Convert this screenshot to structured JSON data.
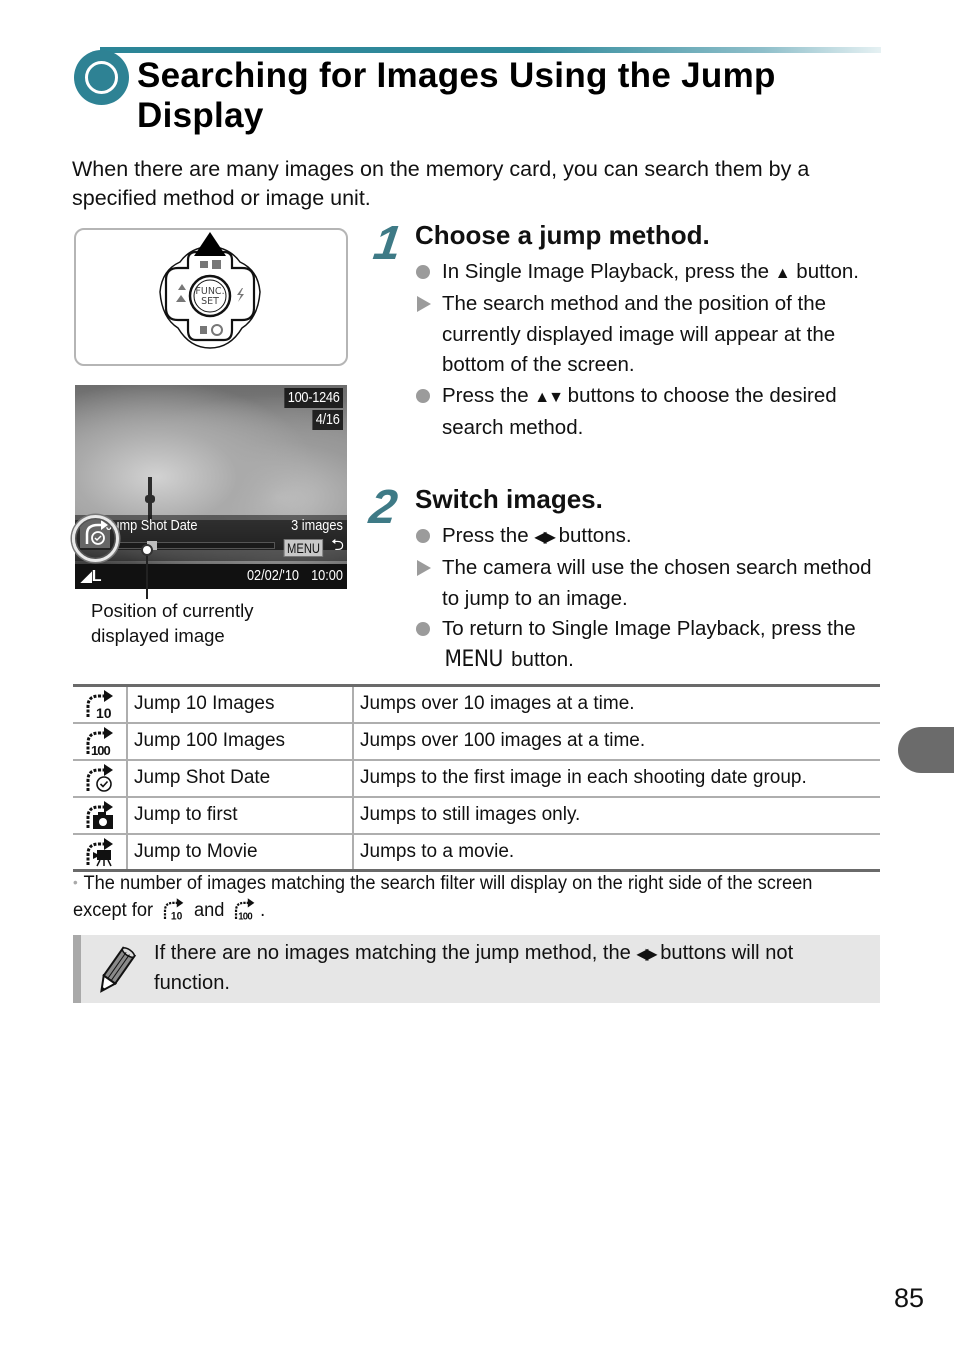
{
  "header": {
    "title": "Searching for Images Using the Jump Display",
    "accent_color": "#2e8294",
    "icon": "section-circle-icon"
  },
  "intro": "When there are many images on the memory card, you can search them by a specified method or image unit.",
  "illustration": {
    "control_pad": {
      "center_label_line1": "FUNC.",
      "center_label_line2": "SET",
      "highlighted_button": "up-arrow"
    },
    "camera_screen": {
      "folder_file": "100-1246",
      "image_count": "4/16",
      "jump_method": "Jump Shot Date",
      "matching_images": "3 images",
      "menu_label": "MENU",
      "return_symbol": "⮌",
      "size_label": "L",
      "date": "02/02/'10",
      "time": "10:00",
      "position_fraction": 0.05
    },
    "caption": "Position of currently displayed image"
  },
  "steps": [
    {
      "number": "1",
      "title": "Choose a jump method.",
      "bullets": [
        {
          "type": "action",
          "parts": [
            "In Single Image Playback, press the ",
            "▲",
            " button."
          ]
        },
        {
          "type": "result",
          "text": "The search method and the position of the currently displayed image will appear at the bottom of the screen."
        },
        {
          "type": "action",
          "parts": [
            "Press the ",
            "▲▼",
            " buttons to choose the desired search method."
          ]
        }
      ]
    },
    {
      "number": "2",
      "title": "Switch images.",
      "bullets": [
        {
          "type": "action",
          "parts": [
            "Press the ",
            "◀▶",
            " buttons."
          ]
        },
        {
          "type": "result",
          "text": "The camera will use the chosen search method to jump to an image."
        },
        {
          "type": "action",
          "parts": [
            "To return to Single Image Playback, press the ",
            "MENU",
            " button."
          ]
        }
      ]
    }
  ],
  "table": {
    "rows": [
      {
        "icon": "jump-10-icon",
        "name": "Jump 10 Images",
        "description": "Jumps over 10 images at a time."
      },
      {
        "icon": "jump-100-icon",
        "name": "Jump 100 Images",
        "description": "Jumps over 100 images at a time."
      },
      {
        "icon": "jump-shot-date-icon",
        "name": "Jump Shot Date",
        "description": "Jumps to the first image in each shooting date group."
      },
      {
        "icon": "jump-to-first-icon",
        "name": "Jump to first",
        "description": "Jumps to still images only."
      },
      {
        "icon": "jump-to-movie-icon",
        "name": "Jump to Movie",
        "description": "Jumps to a movie."
      }
    ]
  },
  "footnote": {
    "bullet": "•",
    "text_before": "The number of images matching the search filter will display on the right side of the screen except for",
    "text_and": "and",
    "text_after": "."
  },
  "note": {
    "icon": "pencil-icon",
    "text_before": "If there are no images matching the jump method, the ",
    "symbol": "◀▶",
    "text_after": " buttons will not function."
  },
  "side_tab_color": "#6b6b6b",
  "page_number": "85"
}
